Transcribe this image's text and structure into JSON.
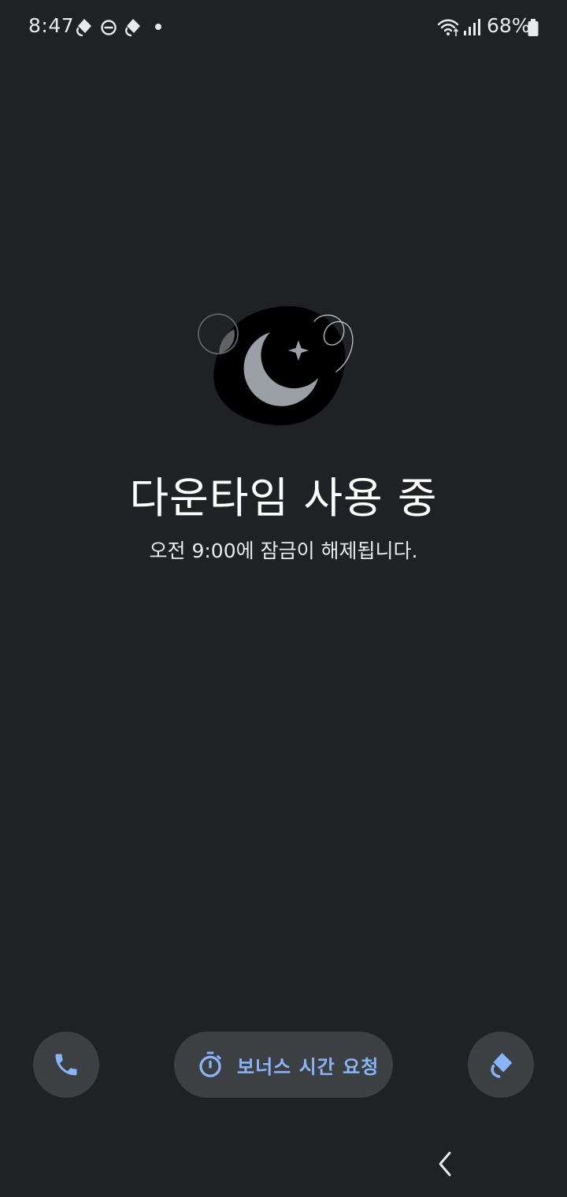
{
  "status_bar": {
    "time": "8:47",
    "battery_percent": "68%",
    "icons": [
      "family-link-icon",
      "do-not-disturb-icon",
      "family-link-icon",
      "notification-dot",
      "wifi-icon",
      "signal-icon",
      "battery-icon"
    ]
  },
  "main": {
    "title": "다운타임 사용 중",
    "subtitle": "오전 9:00에 잠금이 해제됩니다."
  },
  "actions": {
    "bonus_label": "보너스 시간 요청"
  },
  "colors": {
    "background": "#202124",
    "button_bg": "#3c4043",
    "accent": "#8ab4f8",
    "text": "#ffffff"
  }
}
